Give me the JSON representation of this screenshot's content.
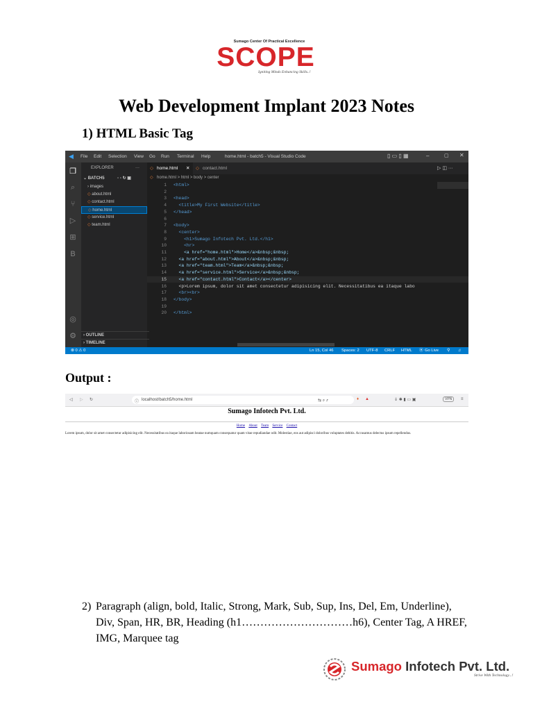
{
  "header_logo": {
    "tagline_top": "Sumago Center Of Practical Excellence",
    "wordmark": "SCOPE",
    "tagline_bottom": "Igniting Minds Enhancing Skills..!"
  },
  "document": {
    "title": "Web Development  Implant 2023 Notes",
    "section1": "1)  HTML Basic Tag",
    "output_label": "Output :",
    "item2_number": "2)",
    "item2_text": "Paragraph (align, bold, Italic, Strong, Mark, Sub, Sup, Ins, Del, Em, Underline), Div, Span, HR, BR, Heading (h1…………………………h6), Center Tag, A HREF, IMG, Marquee tag"
  },
  "vscode": {
    "menu": [
      "File",
      "Edit",
      "Selection",
      "View",
      "Go",
      "Run",
      "Terminal",
      "Help"
    ],
    "window_title": "home.html - batch5 - Visual Studio Code",
    "explorer_label": "EXPLORER",
    "folder": "BATCH5",
    "files": [
      "images",
      "about.html",
      "contact.html",
      "home.html",
      "service.html",
      "team.html"
    ],
    "active_file_index": 3,
    "outline": "OUTLINE",
    "timeline": "TIMELINE",
    "tabs": [
      "home.html",
      "contact.html"
    ],
    "breadcrumb": "home.html > html > body > center",
    "line_numbers": [
      "1",
      "2",
      "3",
      "4",
      "5",
      "6",
      "7",
      "8",
      "9",
      "10",
      "11",
      "12",
      "13",
      "14",
      "15",
      "16",
      "17",
      "18",
      "19",
      "20"
    ],
    "code_lines": [
      "<html>",
      "",
      "<head>",
      "  <title>My First Website</title>",
      "</head>",
      "",
      "<body>",
      "  <center>",
      "    <h1>Sumago Infotech Pvt. Ltd.</h1>",
      "    <hr>",
      "    <a href=\"home.html\">Home</a>&nbsp;&nbsp;",
      "  <a href=\"about.html\">About</a>&nbsp;&nbsp;",
      "  <a href=\"team.html\">Team</a>&nbsp;&nbsp;",
      "  <a href=\"service.html\">Service</a>&nbsp;&nbsp;",
      "  <a href=\"contact.html\">Contact</a></center>",
      "  <p>Lorem ipsum, dolor sit amet consectetur adipisicing elit. Necessitatibus ea itaque labo",
      "  <br><br>",
      "</body>",
      "",
      "</html>"
    ],
    "status_left": "⊗ 0 ⚠ 0",
    "status_right": [
      "Ln 15, Col 46",
      "Spaces: 2",
      "UTF-8",
      "CRLF",
      "HTML",
      "Go Live"
    ]
  },
  "browser": {
    "url": "localhost/batch5/home.html",
    "vpn_label": "VPN",
    "h1": "Sumago Infotech Pvt. Ltd.",
    "nav_links": [
      "Home",
      "About",
      "Team",
      "Service",
      "Contact"
    ],
    "paragraph": "Lorem ipsum, dolor sit amet consectetur adipisicing elit. Necessitatibus ea itaque laboriosam beatae numquam consequatur quam vitae repudiandae odit. Molestiae, eos aut adipisci doloribus voluptates debitis. Accusamus delectus ipsum repellendus."
  },
  "footer_logo": {
    "name_part1": "Sumago",
    "name_part2": " Infotech Pvt. Ltd.",
    "tagline": "Strive With Technology...!"
  },
  "colors": {
    "brand_red": "#d7262a",
    "vscode_bg": "#1e1e1e",
    "vscode_status": "#007acc"
  }
}
